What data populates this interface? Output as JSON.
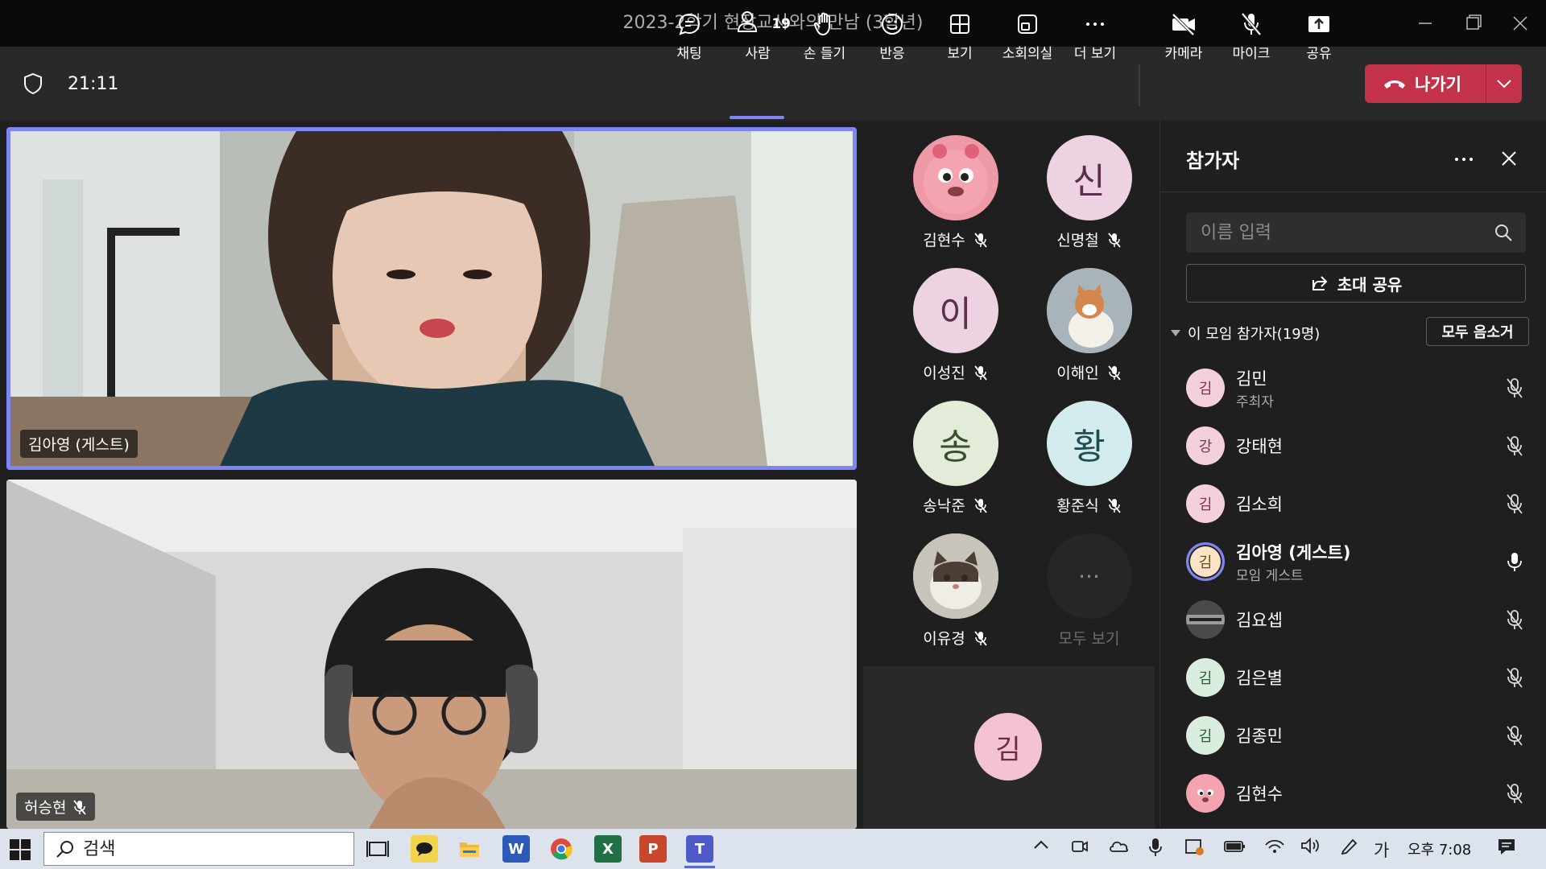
{
  "window": {
    "title": "2023-2학기 현장교사와의 만남 (3학년)"
  },
  "toolbar": {
    "timer": "21:11",
    "people_count": "19",
    "items": [
      {
        "label": "채팅",
        "icon": "chat-icon"
      },
      {
        "label": "사람",
        "icon": "people-icon"
      },
      {
        "label": "손 들기",
        "icon": "raise-hand-icon"
      },
      {
        "label": "반응",
        "icon": "reaction-icon"
      },
      {
        "label": "보기",
        "icon": "view-icon"
      },
      {
        "label": "소회의실",
        "icon": "breakout-rooms-icon"
      },
      {
        "label": "더 보기",
        "icon": "more-icon"
      },
      {
        "label": "카메라",
        "icon": "camera-off-icon"
      },
      {
        "label": "마이크",
        "icon": "mic-off-icon"
      },
      {
        "label": "공유",
        "icon": "share-icon"
      }
    ],
    "leave_label": "나가기"
  },
  "videos": [
    {
      "name": "김아영 (게스트)"
    },
    {
      "name": "허승현"
    }
  ],
  "gallery": [
    {
      "name": "김현수",
      "initial": ""
    },
    {
      "name": "신명철",
      "initial": "신"
    },
    {
      "name": "이성진",
      "initial": "이"
    },
    {
      "name": "이해인",
      "initial": ""
    },
    {
      "name": "송낙준",
      "initial": "송"
    },
    {
      "name": "황준식",
      "initial": "황"
    },
    {
      "name": "이유경",
      "initial": ""
    },
    {
      "name": "모두 보기",
      "initial": "···"
    }
  ],
  "bottom_tile": {
    "initial": "김"
  },
  "panel": {
    "title": "참가자",
    "search_placeholder": "이름 입력",
    "invite_label": "초대 공유",
    "section_title": "이 모임 참가자(19명)",
    "mute_all_label": "모두 음소거",
    "participants": [
      {
        "initial": "김",
        "name": "김민",
        "role": "주최자"
      },
      {
        "initial": "강",
        "name": "강태현",
        "role": ""
      },
      {
        "initial": "김",
        "name": "김소희",
        "role": ""
      },
      {
        "initial": "김",
        "name": "김아영 (게스트)",
        "role": "모임 게스트"
      },
      {
        "initial": "",
        "name": "김요셉",
        "role": ""
      },
      {
        "initial": "김",
        "name": "김은별",
        "role": ""
      },
      {
        "initial": "김",
        "name": "김종민",
        "role": ""
      },
      {
        "initial": "",
        "name": "김현수",
        "role": ""
      }
    ]
  },
  "taskbar": {
    "search_placeholder": "검색",
    "ime": "가",
    "clock": "오후 7:08",
    "apps": [
      {
        "label": "W",
        "icon": "word-icon"
      },
      {
        "label": "X",
        "icon": "excel-icon"
      },
      {
        "label": "P",
        "icon": "powerpoint-icon"
      },
      {
        "label": "T",
        "icon": "teams-icon"
      }
    ]
  }
}
